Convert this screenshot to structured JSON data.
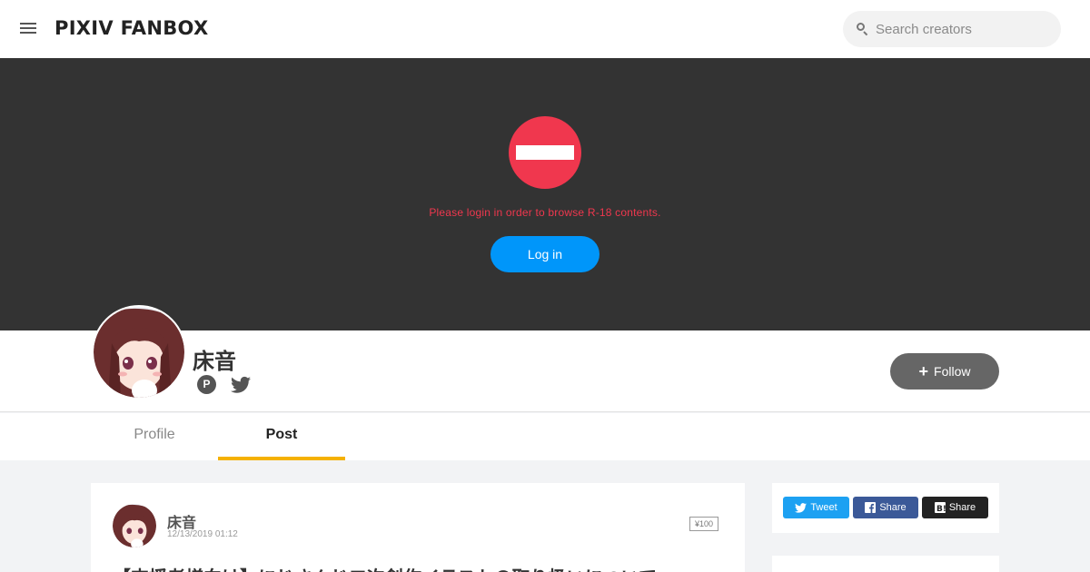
{
  "header": {
    "logo": "PIXIV FANBOX",
    "search_placeholder": "Search creators"
  },
  "cover": {
    "message": "Please login in order to browse R-18 contents.",
    "login_label": "Log in"
  },
  "creator": {
    "name": "床音",
    "pixiv_badge": "P",
    "follow_label": "Follow"
  },
  "tabs": [
    {
      "label": "Profile",
      "active": false
    },
    {
      "label": "Post",
      "active": true
    }
  ],
  "post": {
    "author": "床音",
    "date": "12/13/2019 01:12",
    "price": "¥100",
    "title": "【支援者様向け】にじさんじ二次創作イラストの取り扱いについて"
  },
  "share": {
    "tweet": "Tweet",
    "facebook": "Share",
    "hatena": "Share"
  },
  "colors": {
    "accent_blue": "#0096fa",
    "r18_red": "#f0374e",
    "tab_active": "#f5b100"
  }
}
